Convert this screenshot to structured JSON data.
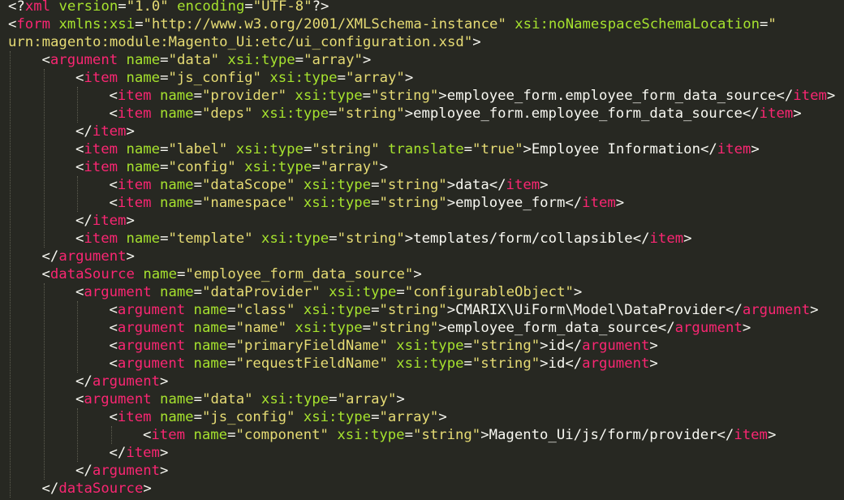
{
  "editor": {
    "theme_colors": {
      "background": "#272822",
      "text": "#f8f8f2",
      "tag_name": "#f92672",
      "attribute": "#a6e22e",
      "string": "#e6db74",
      "indent_guide": "#5f5f52"
    },
    "lines": [
      {
        "indent": 0,
        "tokens": [
          [
            "t",
            "<?"
          ],
          [
            "n",
            "xml"
          ],
          [
            "t",
            " "
          ],
          [
            "a",
            "version"
          ],
          [
            "t",
            "="
          ],
          [
            "s",
            "\"1.0\""
          ],
          [
            "t",
            " "
          ],
          [
            "a",
            "encoding"
          ],
          [
            "t",
            "="
          ],
          [
            "s",
            "\"UTF-8\""
          ],
          [
            "t",
            "?>"
          ]
        ]
      },
      {
        "indent": 0,
        "tokens": [
          [
            "t",
            "<"
          ],
          [
            "n",
            "form"
          ],
          [
            "t",
            " "
          ],
          [
            "a",
            "xmlns:xsi"
          ],
          [
            "t",
            "="
          ],
          [
            "s",
            "\"http://www.w3.org/2001/XMLSchema-instance\""
          ],
          [
            "t",
            " "
          ],
          [
            "a",
            "xsi:noNamespaceSchemaLocation"
          ],
          [
            "t",
            "="
          ],
          [
            "s",
            "\""
          ]
        ]
      },
      {
        "indent": 0,
        "tokens": [
          [
            "s",
            "urn:magento:module:Magento_Ui:etc/ui_configuration.xsd\""
          ],
          [
            "t",
            ">"
          ]
        ]
      },
      {
        "indent": 1,
        "tokens": [
          [
            "t",
            "<"
          ],
          [
            "n",
            "argument"
          ],
          [
            "t",
            " "
          ],
          [
            "a",
            "name"
          ],
          [
            "t",
            "="
          ],
          [
            "s",
            "\"data\""
          ],
          [
            "t",
            " "
          ],
          [
            "a",
            "xsi:type"
          ],
          [
            "t",
            "="
          ],
          [
            "s",
            "\"array\""
          ],
          [
            "t",
            ">"
          ]
        ]
      },
      {
        "indent": 2,
        "tokens": [
          [
            "t",
            "<"
          ],
          [
            "n",
            "item"
          ],
          [
            "t",
            " "
          ],
          [
            "a",
            "name"
          ],
          [
            "t",
            "="
          ],
          [
            "s",
            "\"js_config\""
          ],
          [
            "t",
            " "
          ],
          [
            "a",
            "xsi:type"
          ],
          [
            "t",
            "="
          ],
          [
            "s",
            "\"array\""
          ],
          [
            "t",
            ">"
          ]
        ]
      },
      {
        "indent": 3,
        "tokens": [
          [
            "t",
            "<"
          ],
          [
            "n",
            "item"
          ],
          [
            "t",
            " "
          ],
          [
            "a",
            "name"
          ],
          [
            "t",
            "="
          ],
          [
            "s",
            "\"provider\""
          ],
          [
            "t",
            " "
          ],
          [
            "a",
            "xsi:type"
          ],
          [
            "t",
            "="
          ],
          [
            "s",
            "\"string\""
          ],
          [
            "t",
            ">employee_form.employee_form_data_source</"
          ],
          [
            "n",
            "item"
          ],
          [
            "t",
            ">"
          ]
        ]
      },
      {
        "indent": 3,
        "tokens": [
          [
            "t",
            "<"
          ],
          [
            "n",
            "item"
          ],
          [
            "t",
            " "
          ],
          [
            "a",
            "name"
          ],
          [
            "t",
            "="
          ],
          [
            "s",
            "\"deps\""
          ],
          [
            "t",
            " "
          ],
          [
            "a",
            "xsi:type"
          ],
          [
            "t",
            "="
          ],
          [
            "s",
            "\"string\""
          ],
          [
            "t",
            ">employee_form.employee_form_data_source</"
          ],
          [
            "n",
            "item"
          ],
          [
            "t",
            ">"
          ]
        ]
      },
      {
        "indent": 2,
        "tokens": [
          [
            "t",
            "</"
          ],
          [
            "n",
            "item"
          ],
          [
            "t",
            ">"
          ]
        ]
      },
      {
        "indent": 2,
        "tokens": [
          [
            "t",
            "<"
          ],
          [
            "n",
            "item"
          ],
          [
            "t",
            " "
          ],
          [
            "a",
            "name"
          ],
          [
            "t",
            "="
          ],
          [
            "s",
            "\"label\""
          ],
          [
            "t",
            " "
          ],
          [
            "a",
            "xsi:type"
          ],
          [
            "t",
            "="
          ],
          [
            "s",
            "\"string\""
          ],
          [
            "t",
            " "
          ],
          [
            "a",
            "translate"
          ],
          [
            "t",
            "="
          ],
          [
            "s",
            "\"true\""
          ],
          [
            "t",
            ">Employee Information</"
          ],
          [
            "n",
            "item"
          ],
          [
            "t",
            ">"
          ]
        ]
      },
      {
        "indent": 2,
        "tokens": [
          [
            "t",
            "<"
          ],
          [
            "n",
            "item"
          ],
          [
            "t",
            " "
          ],
          [
            "a",
            "name"
          ],
          [
            "t",
            "="
          ],
          [
            "s",
            "\"config\""
          ],
          [
            "t",
            " "
          ],
          [
            "a",
            "xsi:type"
          ],
          [
            "t",
            "="
          ],
          [
            "s",
            "\"array\""
          ],
          [
            "t",
            ">"
          ]
        ]
      },
      {
        "indent": 3,
        "tokens": [
          [
            "t",
            "<"
          ],
          [
            "n",
            "item"
          ],
          [
            "t",
            " "
          ],
          [
            "a",
            "name"
          ],
          [
            "t",
            "="
          ],
          [
            "s",
            "\"dataScope\""
          ],
          [
            "t",
            " "
          ],
          [
            "a",
            "xsi:type"
          ],
          [
            "t",
            "="
          ],
          [
            "s",
            "\"string\""
          ],
          [
            "t",
            ">data</"
          ],
          [
            "n",
            "item"
          ],
          [
            "t",
            ">"
          ]
        ]
      },
      {
        "indent": 3,
        "tokens": [
          [
            "t",
            "<"
          ],
          [
            "n",
            "item"
          ],
          [
            "t",
            " "
          ],
          [
            "a",
            "name"
          ],
          [
            "t",
            "="
          ],
          [
            "s",
            "\"namespace\""
          ],
          [
            "t",
            " "
          ],
          [
            "a",
            "xsi:type"
          ],
          [
            "t",
            "="
          ],
          [
            "s",
            "\"string\""
          ],
          [
            "t",
            ">employee_form</"
          ],
          [
            "n",
            "item"
          ],
          [
            "t",
            ">"
          ]
        ]
      },
      {
        "indent": 2,
        "tokens": [
          [
            "t",
            "</"
          ],
          [
            "n",
            "item"
          ],
          [
            "t",
            ">"
          ]
        ]
      },
      {
        "indent": 2,
        "tokens": [
          [
            "t",
            "<"
          ],
          [
            "n",
            "item"
          ],
          [
            "t",
            " "
          ],
          [
            "a",
            "name"
          ],
          [
            "t",
            "="
          ],
          [
            "s",
            "\"template\""
          ],
          [
            "t",
            " "
          ],
          [
            "a",
            "xsi:type"
          ],
          [
            "t",
            "="
          ],
          [
            "s",
            "\"string\""
          ],
          [
            "t",
            ">templates/form/collapsible</"
          ],
          [
            "n",
            "item"
          ],
          [
            "t",
            ">"
          ]
        ]
      },
      {
        "indent": 1,
        "tokens": [
          [
            "t",
            "</"
          ],
          [
            "n",
            "argument"
          ],
          [
            "t",
            ">"
          ]
        ]
      },
      {
        "indent": 1,
        "tokens": [
          [
            "t",
            "<"
          ],
          [
            "n",
            "dataSource"
          ],
          [
            "t",
            " "
          ],
          [
            "a",
            "name"
          ],
          [
            "t",
            "="
          ],
          [
            "s",
            "\"employee_form_data_source\""
          ],
          [
            "t",
            ">"
          ]
        ]
      },
      {
        "indent": 2,
        "tokens": [
          [
            "t",
            "<"
          ],
          [
            "n",
            "argument"
          ],
          [
            "t",
            " "
          ],
          [
            "a",
            "name"
          ],
          [
            "t",
            "="
          ],
          [
            "s",
            "\"dataProvider\""
          ],
          [
            "t",
            " "
          ],
          [
            "a",
            "xsi:type"
          ],
          [
            "t",
            "="
          ],
          [
            "s",
            "\"configurableObject\""
          ],
          [
            "t",
            ">"
          ]
        ]
      },
      {
        "indent": 3,
        "tokens": [
          [
            "t",
            "<"
          ],
          [
            "n",
            "argument"
          ],
          [
            "t",
            " "
          ],
          [
            "a",
            "name"
          ],
          [
            "t",
            "="
          ],
          [
            "s",
            "\"class\""
          ],
          [
            "t",
            " "
          ],
          [
            "a",
            "xsi:type"
          ],
          [
            "t",
            "="
          ],
          [
            "s",
            "\"string\""
          ],
          [
            "t",
            ">CMARIX\\UiForm\\Model\\DataProvider</"
          ],
          [
            "n",
            "argument"
          ],
          [
            "t",
            ">"
          ]
        ]
      },
      {
        "indent": 3,
        "tokens": [
          [
            "t",
            "<"
          ],
          [
            "n",
            "argument"
          ],
          [
            "t",
            " "
          ],
          [
            "a",
            "name"
          ],
          [
            "t",
            "="
          ],
          [
            "s",
            "\"name\""
          ],
          [
            "t",
            " "
          ],
          [
            "a",
            "xsi:type"
          ],
          [
            "t",
            "="
          ],
          [
            "s",
            "\"string\""
          ],
          [
            "t",
            ">employee_form_data_source</"
          ],
          [
            "n",
            "argument"
          ],
          [
            "t",
            ">"
          ]
        ]
      },
      {
        "indent": 3,
        "tokens": [
          [
            "t",
            "<"
          ],
          [
            "n",
            "argument"
          ],
          [
            "t",
            " "
          ],
          [
            "a",
            "name"
          ],
          [
            "t",
            "="
          ],
          [
            "s",
            "\"primaryFieldName\""
          ],
          [
            "t",
            " "
          ],
          [
            "a",
            "xsi:type"
          ],
          [
            "t",
            "="
          ],
          [
            "s",
            "\"string\""
          ],
          [
            "t",
            ">id</"
          ],
          [
            "n",
            "argument"
          ],
          [
            "t",
            ">"
          ]
        ]
      },
      {
        "indent": 3,
        "tokens": [
          [
            "t",
            "<"
          ],
          [
            "n",
            "argument"
          ],
          [
            "t",
            " "
          ],
          [
            "a",
            "name"
          ],
          [
            "t",
            "="
          ],
          [
            "s",
            "\"requestFieldName\""
          ],
          [
            "t",
            " "
          ],
          [
            "a",
            "xsi:type"
          ],
          [
            "t",
            "="
          ],
          [
            "s",
            "\"string\""
          ],
          [
            "t",
            ">id</"
          ],
          [
            "n",
            "argument"
          ],
          [
            "t",
            ">"
          ]
        ]
      },
      {
        "indent": 2,
        "tokens": [
          [
            "t",
            "</"
          ],
          [
            "n",
            "argument"
          ],
          [
            "t",
            ">"
          ]
        ]
      },
      {
        "indent": 2,
        "tokens": [
          [
            "t",
            "<"
          ],
          [
            "n",
            "argument"
          ],
          [
            "t",
            " "
          ],
          [
            "a",
            "name"
          ],
          [
            "t",
            "="
          ],
          [
            "s",
            "\"data\""
          ],
          [
            "t",
            " "
          ],
          [
            "a",
            "xsi:type"
          ],
          [
            "t",
            "="
          ],
          [
            "s",
            "\"array\""
          ],
          [
            "t",
            ">"
          ]
        ]
      },
      {
        "indent": 3,
        "tokens": [
          [
            "t",
            "<"
          ],
          [
            "n",
            "item"
          ],
          [
            "t",
            " "
          ],
          [
            "a",
            "name"
          ],
          [
            "t",
            "="
          ],
          [
            "s",
            "\"js_config\""
          ],
          [
            "t",
            " "
          ],
          [
            "a",
            "xsi:type"
          ],
          [
            "t",
            "="
          ],
          [
            "s",
            "\"array\""
          ],
          [
            "t",
            ">"
          ]
        ]
      },
      {
        "indent": 4,
        "tokens": [
          [
            "t",
            "<"
          ],
          [
            "n",
            "item"
          ],
          [
            "t",
            " "
          ],
          [
            "a",
            "name"
          ],
          [
            "t",
            "="
          ],
          [
            "s",
            "\"component\""
          ],
          [
            "t",
            " "
          ],
          [
            "a",
            "xsi:type"
          ],
          [
            "t",
            "="
          ],
          [
            "s",
            "\"string\""
          ],
          [
            "t",
            ">Magento_Ui/js/form/provider</"
          ],
          [
            "n",
            "item"
          ],
          [
            "t",
            ">"
          ]
        ]
      },
      {
        "indent": 3,
        "tokens": [
          [
            "t",
            "</"
          ],
          [
            "n",
            "item"
          ],
          [
            "t",
            ">"
          ]
        ]
      },
      {
        "indent": 2,
        "tokens": [
          [
            "t",
            "</"
          ],
          [
            "n",
            "argument"
          ],
          [
            "t",
            ">"
          ]
        ]
      },
      {
        "indent": 1,
        "tokens": [
          [
            "t",
            "</"
          ],
          [
            "n",
            "dataSource"
          ],
          [
            "t",
            ">"
          ]
        ]
      }
    ]
  }
}
